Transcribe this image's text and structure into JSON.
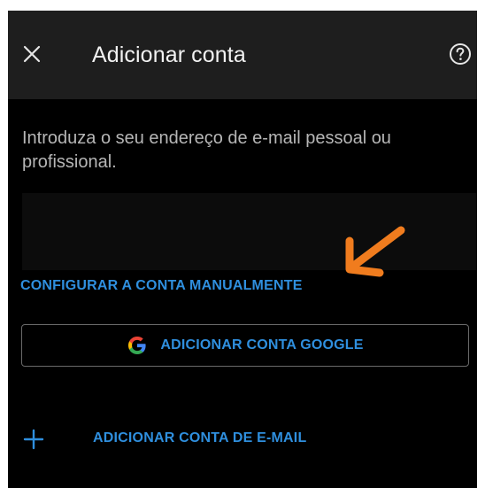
{
  "header": {
    "title": "Adicionar conta",
    "close_icon": "close-icon",
    "help_icon": "help-circle-icon"
  },
  "intro_text": "Introduza o seu endereço de e-mail pessoal ou profissional.",
  "email_field": {
    "value": "",
    "placeholder": ""
  },
  "annotation": {
    "arrow_icon": "arrow-pointer-icon",
    "color": "#f07c1e"
  },
  "manual_setup_link": "CONFIGURAR A CONTA MANUALMENTE",
  "google_button": {
    "label": "ADICIONAR CONTA GOOGLE",
    "icon": "google-g-icon"
  },
  "add_email": {
    "label": "ADICIONAR CONTA DE E-MAIL",
    "icon": "plus-icon"
  },
  "colors": {
    "background": "#000000",
    "app_bar": "#1e1e1e",
    "accent": "#2f8fde",
    "annotation_arrow": "#f07c1e"
  }
}
